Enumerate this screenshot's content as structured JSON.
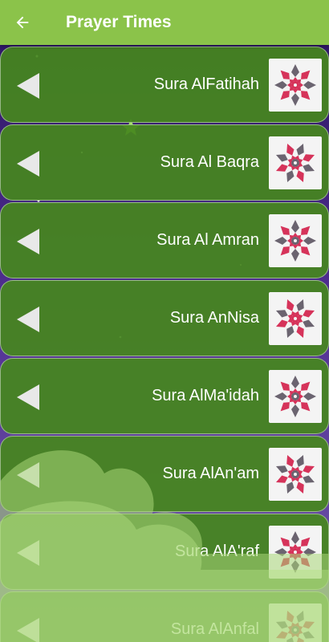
{
  "appbar": {
    "title": "Prayer Times",
    "back_icon": "arrow-left-icon",
    "color": "#8bc34a"
  },
  "list": {
    "items": [
      {
        "label": "Sura AlFatihah",
        "icon": "islamic-pattern-icon"
      },
      {
        "label": "Sura Al Baqra",
        "icon": "islamic-pattern-icon"
      },
      {
        "label": "Sura Al Amran",
        "icon": "islamic-pattern-icon"
      },
      {
        "label": "Sura AnNisa",
        "icon": "islamic-pattern-icon"
      },
      {
        "label": "Sura AlMa'idah",
        "icon": "islamic-pattern-icon"
      },
      {
        "label": "Sura AlAn'am",
        "icon": "islamic-pattern-icon"
      },
      {
        "label": "Sura AlA'raf",
        "icon": "islamic-pattern-icon"
      },
      {
        "label": "Sura AlAnfal",
        "icon": "islamic-pattern-icon"
      }
    ],
    "card_color": "#46871e",
    "pattern_colors": [
      "#d6335a",
      "#6b6470"
    ]
  }
}
